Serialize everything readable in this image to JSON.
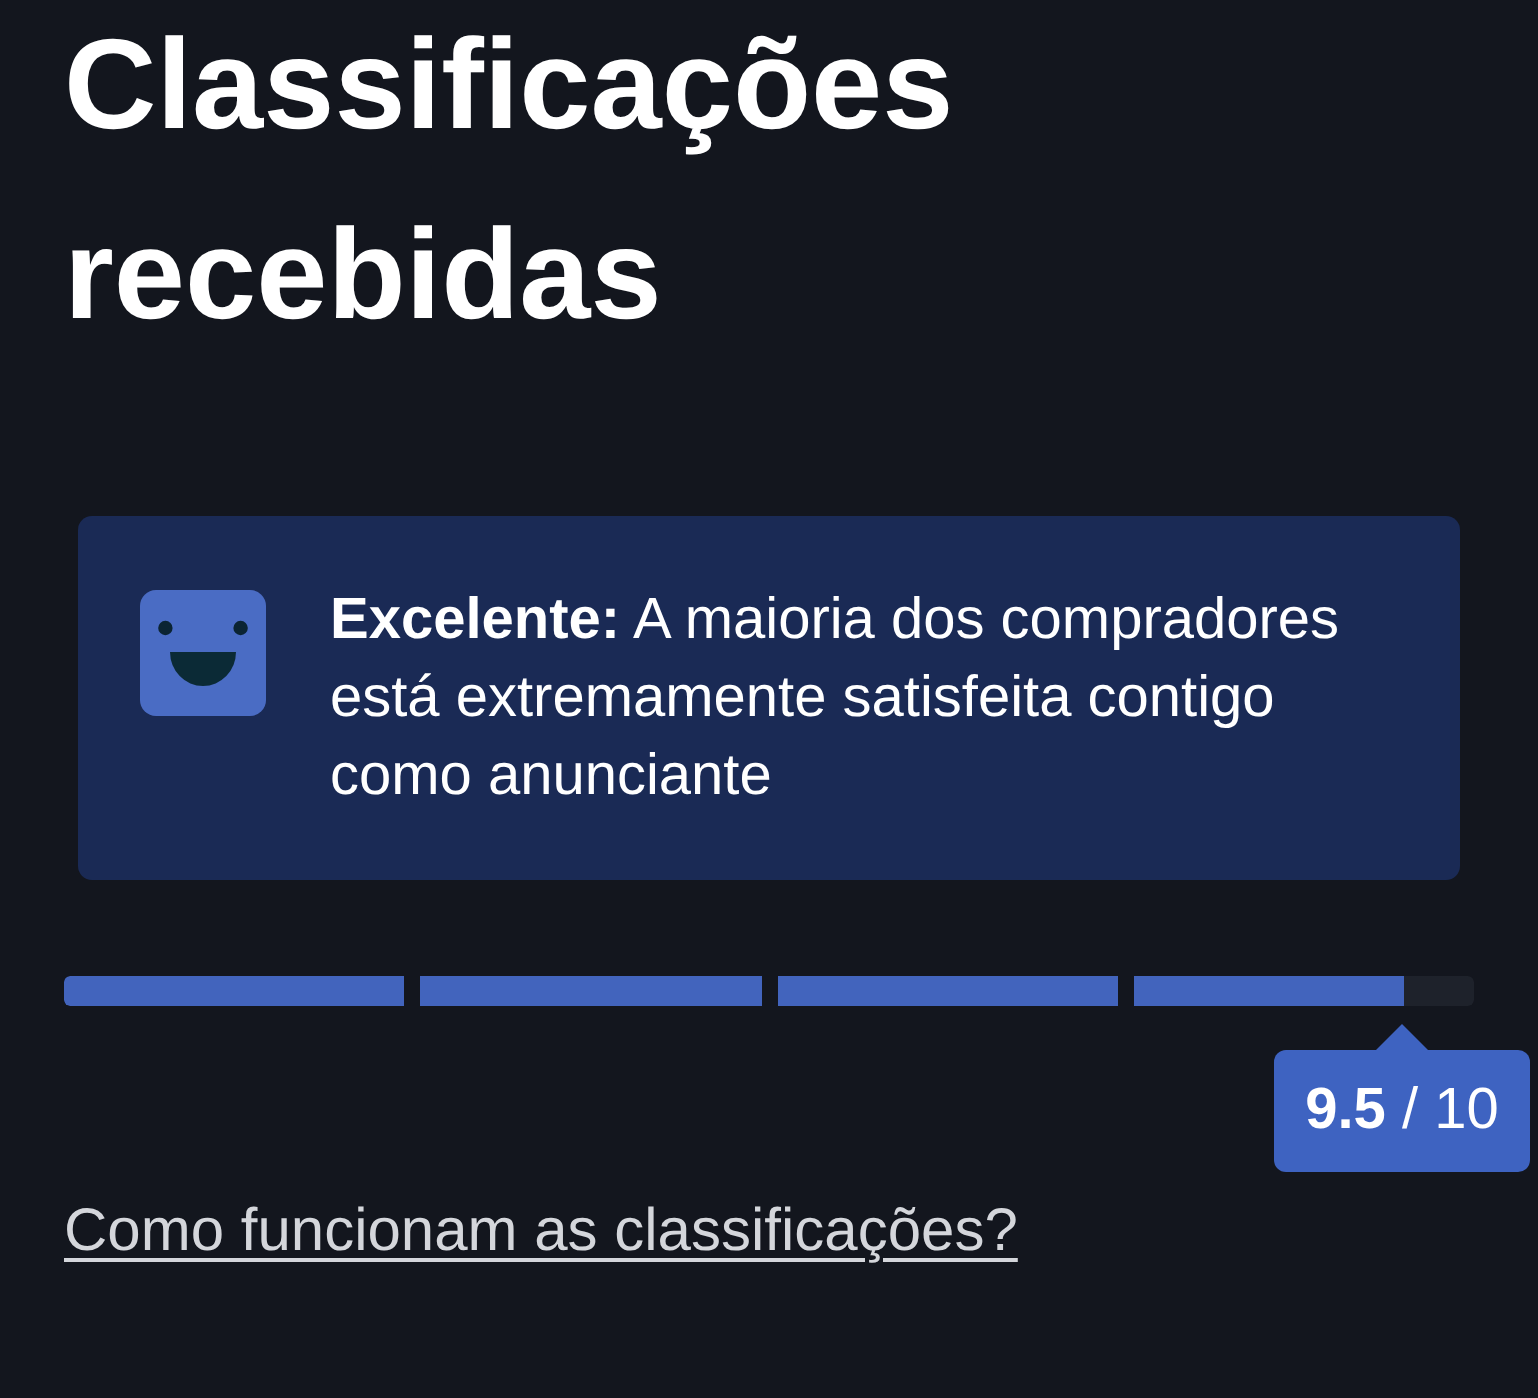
{
  "title": "Classificações recebidas",
  "rating_card": {
    "message": "**Excelente:** A maioria dos compradores está extremamente satisfeita contigo como anunciante"
  },
  "score_bar": {
    "level": 0.95
  },
  "score_tooltip": {
    "text": "**9.5** / 10"
  },
  "help_link": "Como funcionam as classificações?"
}
